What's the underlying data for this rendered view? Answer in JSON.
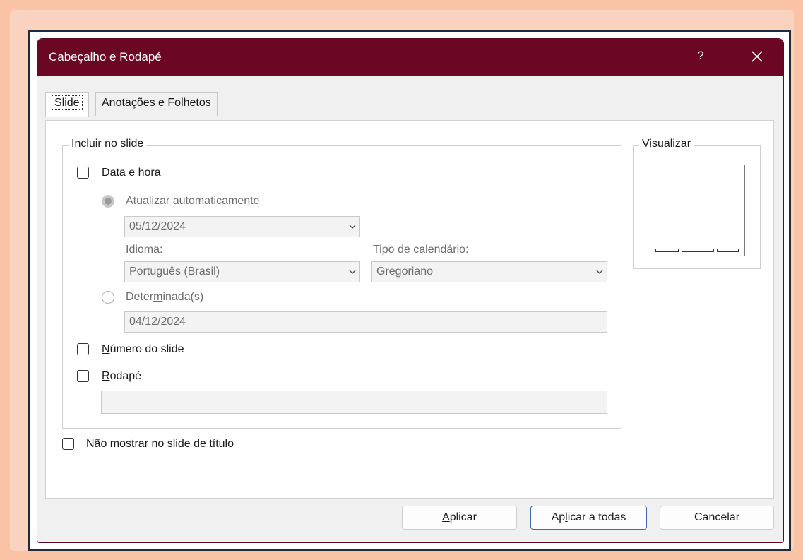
{
  "dialog": {
    "title": "Cabeçalho e Rodapé",
    "help": "?",
    "close_icon": "close-icon"
  },
  "tabs": {
    "slide": "Slide",
    "notes": "Anotações e Folhetos"
  },
  "include_group": {
    "legend": "Incluir no slide",
    "date_time": {
      "pre": "",
      "key": "D",
      "post": "ata e hora",
      "checked": false
    },
    "auto_update": {
      "pre": "A",
      "key": "t",
      "post": "ualizar automaticamente",
      "selected": true
    },
    "auto_date_value": "05/12/2024",
    "language_label": {
      "pre": "",
      "key": "I",
      "post": "dioma:"
    },
    "language_value": "Português (Brasil)",
    "calendar_label": {
      "pre": "Tip",
      "key": "o",
      "post": " de calendário:"
    },
    "calendar_value": "Gregoriano",
    "fixed": {
      "pre": "Deter",
      "key": "m",
      "post": "inada(s)",
      "selected": false
    },
    "fixed_value": "04/12/2024",
    "slide_number": {
      "pre": "",
      "key": "N",
      "post": "úmero do slide",
      "checked": false
    },
    "footer": {
      "pre": "",
      "key": "R",
      "post": "odapé",
      "checked": false
    },
    "footer_value": ""
  },
  "dont_show_title": {
    "pre": "Não mostrar no slid",
    "key": "e",
    "post": " de título",
    "checked": false
  },
  "preview": {
    "legend": "Visualizar"
  },
  "buttons": {
    "apply": {
      "pre": "",
      "key": "A",
      "post": "plicar"
    },
    "apply_all": {
      "pre": "Ap",
      "key": "l",
      "post": "icar a todas"
    },
    "cancel": "Cancelar"
  }
}
